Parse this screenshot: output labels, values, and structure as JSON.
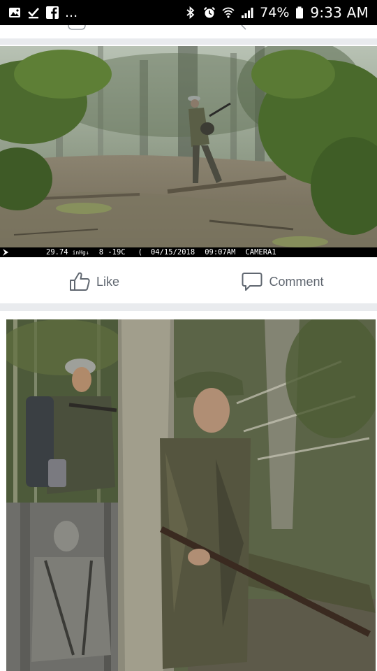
{
  "status_bar": {
    "battery_percent": "74%",
    "time": "9:33 AM",
    "overflow": "...",
    "icons_left": [
      "gallery-icon",
      "download-check-icon",
      "facebook-icon"
    ],
    "icons_right": [
      "bluetooth-icon",
      "alarm-icon",
      "wifi-icon",
      "signal-icon",
      "battery-icon"
    ]
  },
  "post1": {
    "camera_stamp": {
      "pressure": "29.74",
      "pressure_unit": "inHg",
      "pressure_trend": "↓",
      "temperature": "8 -19C",
      "date": "04/15/2018",
      "time": "09:07AM",
      "camera": "CAMERA1"
    },
    "actions": {
      "like": "Like",
      "comment": "Comment"
    }
  },
  "colors": {
    "feed_bg": "#e9ebee",
    "card_bg": "#ffffff",
    "action_text": "#606770"
  }
}
